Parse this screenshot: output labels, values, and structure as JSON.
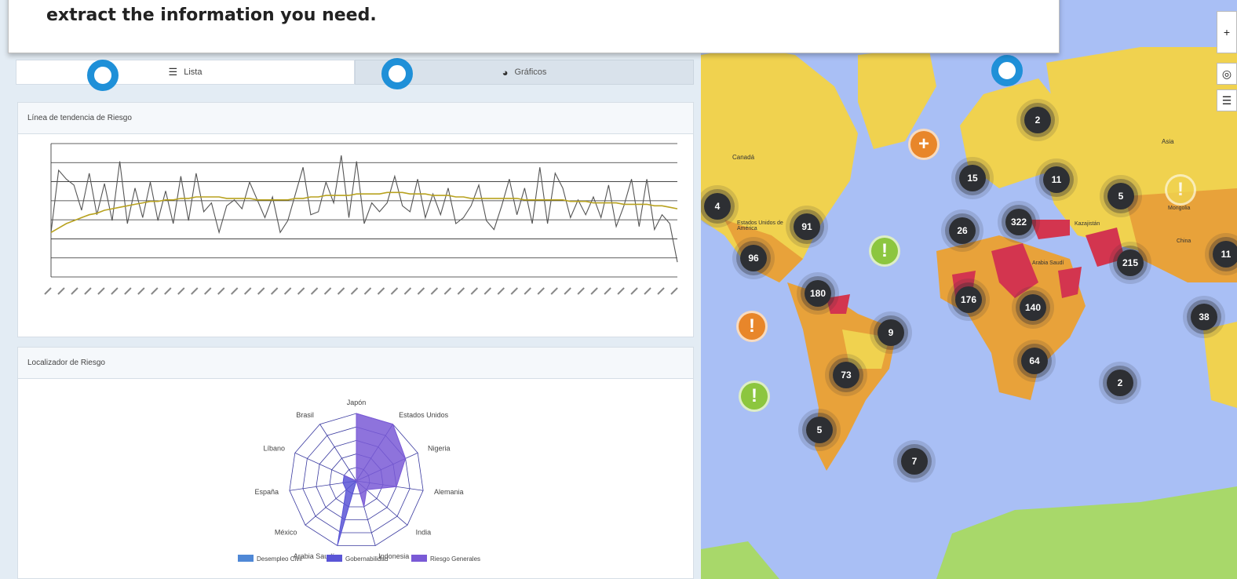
{
  "banner": {
    "text": "extract the information you need."
  },
  "tabs": [
    {
      "label": "Lista",
      "icon": "list-icon",
      "active": true
    },
    {
      "label": "Gráficos",
      "icon": "pie-chart-icon",
      "active": false
    }
  ],
  "trend_card": {
    "title": "Línea de tendencia de Riesgo"
  },
  "radar_card": {
    "title": "Localizador de Riesgo"
  },
  "chart_data": [
    {
      "type": "line",
      "title": "Línea de tendencia de Riesgo",
      "x_tick_count": 48,
      "series": [
        {
          "color": "#555555",
          "values": [
            30,
            72,
            66,
            62,
            45,
            70,
            42,
            63,
            38,
            78,
            36,
            60,
            40,
            64,
            38,
            58,
            36,
            68,
            38,
            70,
            44,
            50,
            30,
            48,
            52,
            46,
            64,
            52,
            40,
            54,
            30,
            38,
            56,
            74,
            42,
            44,
            64,
            50,
            82,
            40,
            78,
            36,
            50,
            44,
            50,
            68,
            48,
            44,
            66,
            40,
            56,
            42,
            60,
            36,
            40,
            48,
            62,
            38,
            32,
            48,
            66,
            42,
            60,
            36,
            74,
            36,
            70,
            60,
            40,
            52,
            42,
            54,
            40,
            62,
            34,
            48,
            66,
            34,
            66,
            32,
            42,
            36,
            10
          ],
          "name": ""
        },
        {
          "color": "#b8a21f",
          "values": [
            30,
            33,
            36,
            38,
            40,
            42,
            43,
            45,
            46,
            47,
            48,
            49,
            50,
            51,
            51,
            52,
            52,
            53,
            53,
            54,
            54,
            54,
            54,
            53,
            53,
            53,
            53,
            52,
            52,
            52,
            52,
            52,
            53,
            53,
            54,
            54,
            55,
            55,
            55,
            55,
            56,
            56,
            56,
            56,
            57,
            57,
            57,
            56,
            56,
            56,
            55,
            55,
            55,
            54,
            54,
            53,
            53,
            53,
            53,
            53,
            53,
            53,
            52,
            52,
            52,
            52,
            52,
            52,
            51,
            51,
            51,
            50,
            50,
            50,
            50,
            49,
            49,
            49,
            49,
            48,
            48,
            47,
            46
          ],
          "name": ""
        }
      ]
    },
    {
      "type": "radar",
      "title": "Localizador de Riesgo",
      "categories": [
        "Japón",
        "Estados Unidos",
        "Nigeria",
        "Alemania",
        "India",
        "Indonesia",
        "Arabia Saudí",
        "México",
        "España",
        "Líbano",
        "Brasil"
      ],
      "rings": 5,
      "series": [
        {
          "name": "Desempleo Civil",
          "color": "#4f88d6",
          "values": [
            0,
            0,
            0,
            0,
            0,
            0,
            0,
            0,
            0,
            0,
            0
          ]
        },
        {
          "name": "Gobernabilidad",
          "color": "#5a55d6",
          "values": [
            0,
            0,
            0,
            0,
            0,
            0,
            5,
            1,
            1,
            1,
            0
          ]
        },
        {
          "name": "Riesgo Generales",
          "color": "#7a5ad6",
          "values": [
            5,
            5,
            4,
            3,
            1,
            2,
            0,
            0,
            0,
            1,
            0
          ]
        }
      ]
    }
  ],
  "map": {
    "labels": [
      "Asia",
      "Canadá",
      "Estados Unidos de América",
      "Mongolia",
      "Arabia Saudí",
      "China",
      "Kazajistán"
    ],
    "clusters": [
      "2",
      "15",
      "11",
      "5",
      "4",
      "91",
      "26",
      "322",
      "96",
      "215",
      "180",
      "176",
      "140",
      "9",
      "64",
      "73",
      "2",
      "5",
      "7",
      "38",
      "11"
    ],
    "controls": {
      "zoom_in": "+",
      "locate": "◎",
      "layers": "☰"
    }
  }
}
